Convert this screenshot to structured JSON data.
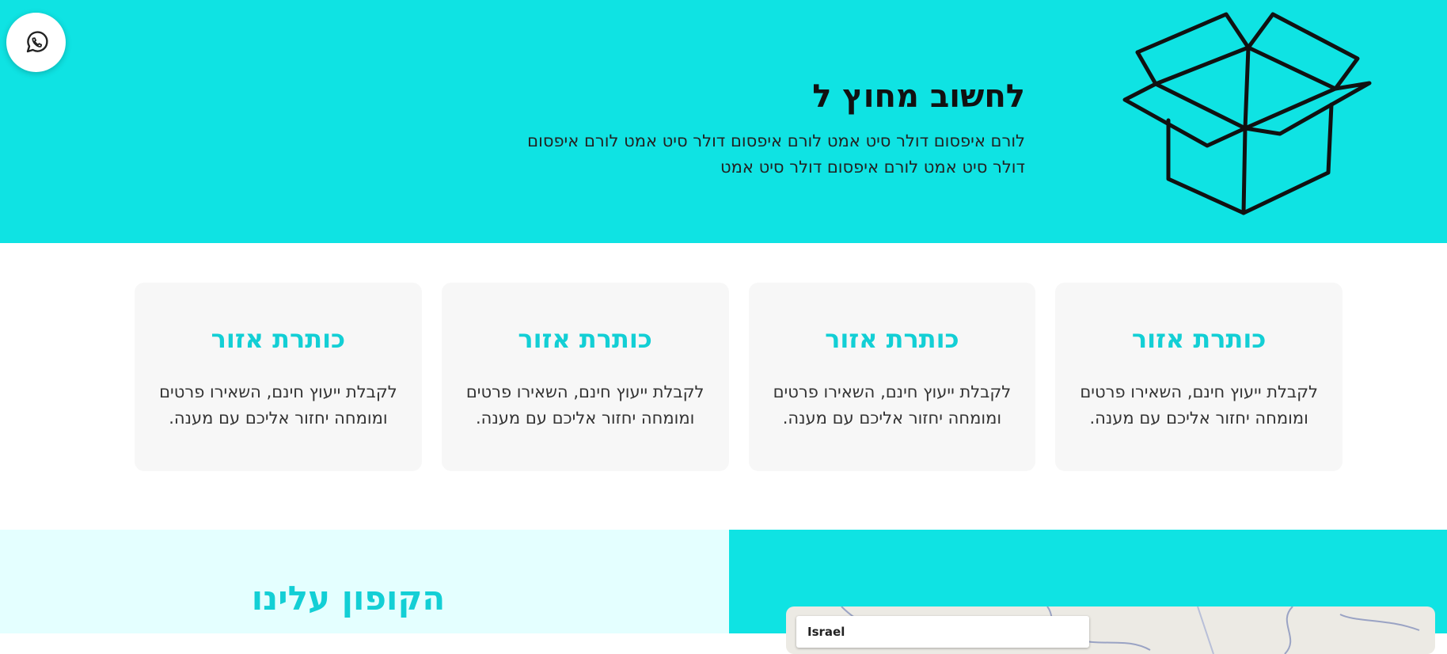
{
  "hero": {
    "title": "לחשוב מחוץ ל",
    "text": "לורם איפסום דולר סיט אמט לורם איפסום דולר סיט אמט לורם איפסום דולר סיט אמט לורם איפסום דולר סיט אמט",
    "illustration": "open-box-icon"
  },
  "whatsapp": {
    "icon": "whatsapp-icon"
  },
  "cards": [
    {
      "title": "כותרת אזור",
      "text": "לקבלת ייעוץ חינם, השאירו פרטים ומומחה יחזור אליכם עם מענה."
    },
    {
      "title": "כותרת אזור",
      "text": "לקבלת ייעוץ חינם, השאירו פרטים ומומחה יחזור אליכם עם מענה."
    },
    {
      "title": "כותרת אזור",
      "text": "לקבלת ייעוץ חינם, השאירו פרטים ומומחה יחזור אליכם עם מענה."
    },
    {
      "title": "כותרת אזור",
      "text": "לקבלת ייעוץ חינם, השאירו פרטים ומומחה יחזור אליכם עם מענה."
    }
  ],
  "coupon": {
    "title": "הקופון עלינו"
  },
  "map": {
    "place": "Israel"
  },
  "colors": {
    "accent": "#0fe3e3",
    "heading": "#13cfd5",
    "card_bg": "#f7f7f7",
    "coupon_bg": "#e4ffff"
  }
}
